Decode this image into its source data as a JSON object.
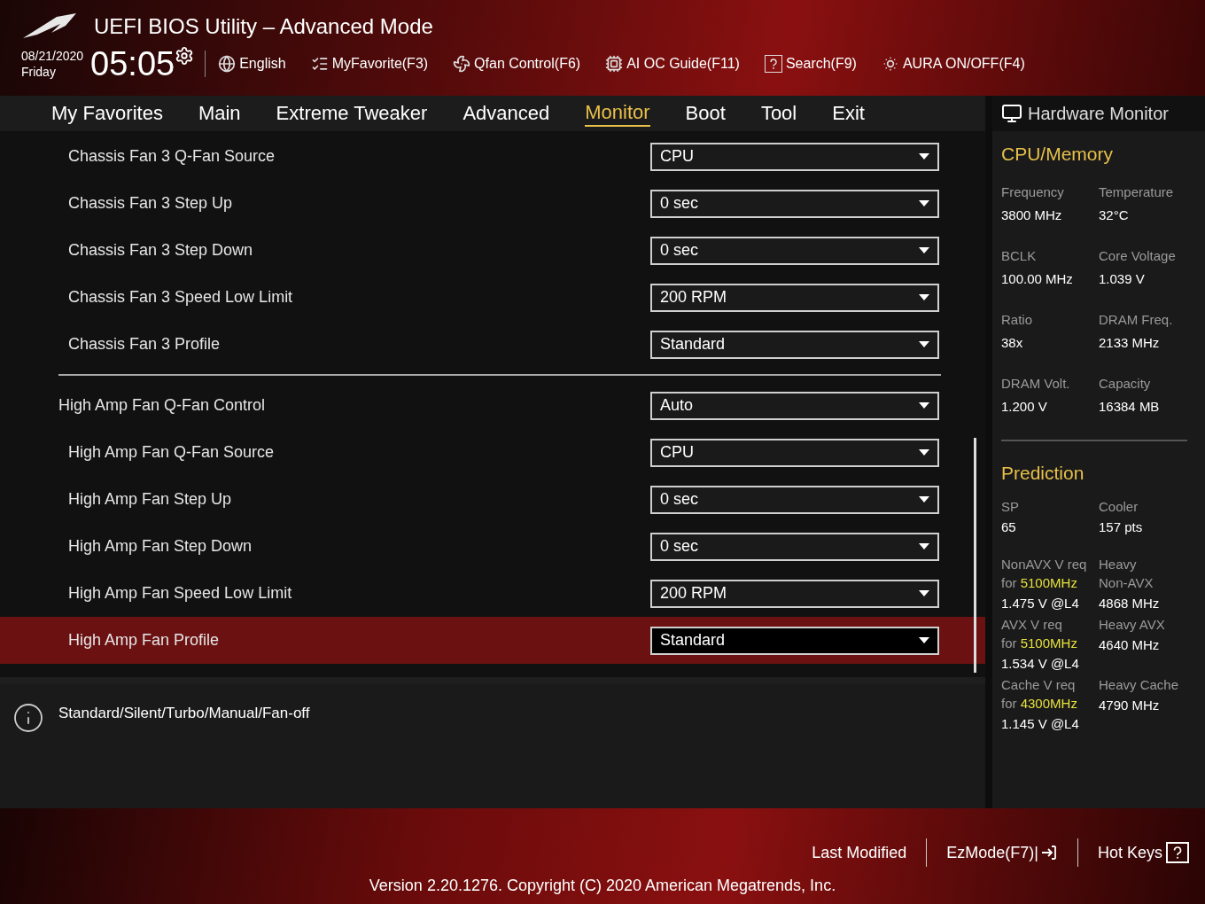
{
  "header": {
    "title": "UEFI BIOS Utility – Advanced Mode",
    "date": "08/21/2020",
    "day": "Friday",
    "time": "05:05",
    "tools": [
      {
        "kind": "language",
        "label": "English"
      },
      {
        "kind": "favorite",
        "label": "MyFavorite(F3)"
      },
      {
        "kind": "fan",
        "label": "Qfan Control(F6)"
      },
      {
        "kind": "ai",
        "label": "AI OC Guide(F11)"
      },
      {
        "kind": "search",
        "label": "Search(F9)"
      },
      {
        "kind": "aura",
        "label": "AURA ON/OFF(F4)"
      }
    ]
  },
  "tabs": [
    {
      "label": "My Favorites",
      "selected": false
    },
    {
      "label": "Main",
      "selected": false
    },
    {
      "label": "Extreme Tweaker",
      "selected": false
    },
    {
      "label": "Advanced",
      "selected": false
    },
    {
      "label": "Monitor",
      "selected": true
    },
    {
      "label": "Boot",
      "selected": false
    },
    {
      "label": "Tool",
      "selected": false
    },
    {
      "label": "Exit",
      "selected": false
    }
  ],
  "settings": [
    {
      "children": [
        {
          "label": "Chassis Fan 3 Q-Fan Source",
          "value": "CPU",
          "selected": false
        },
        {
          "label": "Chassis Fan 3 Step Up",
          "value": "0 sec",
          "selected": false
        },
        {
          "label": "Chassis Fan 3 Step Down",
          "value": "0 sec",
          "selected": false
        },
        {
          "label": "Chassis Fan 3 Speed Low Limit",
          "value": "200 RPM",
          "selected": false
        },
        {
          "label": "Chassis Fan 3 Profile",
          "value": "Standard",
          "selected": false
        }
      ]
    },
    {
      "label": "High Amp Fan Q-Fan Control",
      "value": "Auto",
      "selected": false,
      "children": [
        {
          "label": "High Amp Fan Q-Fan Source",
          "value": "CPU",
          "selected": false
        },
        {
          "label": "High Amp Fan Step Up",
          "value": "0 sec",
          "selected": false
        },
        {
          "label": "High Amp Fan Step Down",
          "value": "0 sec",
          "selected": false
        },
        {
          "label": "High Amp Fan Speed Low Limit",
          "value": "200 RPM",
          "selected": false
        },
        {
          "label": "High Amp Fan Profile",
          "value": "Standard",
          "selected": true
        }
      ]
    }
  ],
  "help_text": "Standard/Silent/Turbo/Manual/Fan-off",
  "hardware_monitor": {
    "title": "Hardware Monitor",
    "cpu_memory": {
      "title": "CPU/Memory",
      "items": [
        {
          "label": "Frequency",
          "value": "3800 MHz"
        },
        {
          "label": "Temperature",
          "value": "32°C"
        },
        {
          "label": "BCLK",
          "value": "100.00 MHz"
        },
        {
          "label": "Core Voltage",
          "value": "1.039 V"
        },
        {
          "label": "Ratio",
          "value": "38x"
        },
        {
          "label": "DRAM Freq.",
          "value": "2133 MHz"
        },
        {
          "label": "DRAM Volt.",
          "value": "1.200 V"
        },
        {
          "label": "Capacity",
          "value": "16384 MB"
        }
      ]
    },
    "prediction": {
      "title": "Prediction",
      "rows": [
        {
          "left": {
            "label": [
              "SP"
            ],
            "value": "65"
          },
          "right": {
            "label": [
              "Cooler"
            ],
            "value": "157 pts"
          }
        },
        {
          "left": {
            "label": [
              "NonAVX V req",
              "for **5100MHz**"
            ],
            "value": "1.475 V @L4"
          },
          "right": {
            "label": [
              "Heavy",
              "Non-AVX"
            ],
            "value": "4868 MHz"
          }
        },
        {
          "left": {
            "label": [
              "AVX V req",
              "for **5100MHz**"
            ],
            "value": "1.534 V @L4"
          },
          "right": {
            "label": [
              "Heavy AVX"
            ],
            "value": "4640 MHz"
          }
        },
        {
          "left": {
            "label": [
              "Cache V req",
              "for **4300MHz**"
            ],
            "value": "1.145 V @L4"
          },
          "right": {
            "label": [
              "Heavy Cache"
            ],
            "value": "4790 MHz"
          }
        }
      ]
    }
  },
  "footer": {
    "actions": [
      {
        "kind": "last",
        "label": "Last Modified"
      },
      {
        "kind": "ezmode",
        "label": "EzMode(F7)|"
      },
      {
        "kind": "hotkeys",
        "label": "Hot Keys"
      }
    ],
    "version": "Version 2.20.1276. Copyright (C) 2020 American Megatrends, Inc."
  }
}
